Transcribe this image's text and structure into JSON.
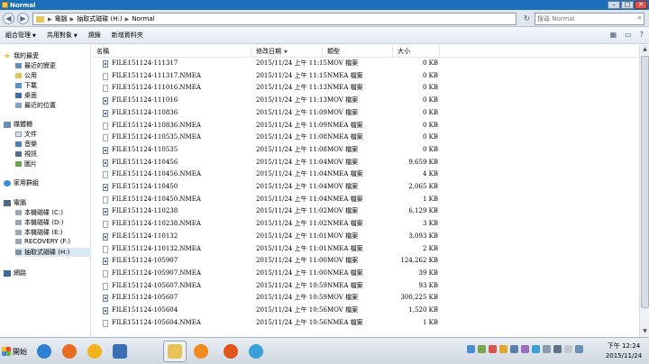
{
  "window": {
    "title": "Normal",
    "controls": {
      "minimize": "–",
      "maximize": "□",
      "close": "✕"
    }
  },
  "address": {
    "crumbs": [
      "電腦",
      "抽取式磁碟 (H:)",
      "Normal"
    ],
    "search_placeholder": "搜尋 Normal"
  },
  "toolbar": {
    "organize": "組合管理",
    "share": "共用對象",
    "burn": "燒錄",
    "new_folder": "新增資料夾"
  },
  "nav": {
    "favorites": {
      "label": "我的最愛",
      "items": [
        "最近的變更",
        "公用",
        "下載",
        "桌面",
        "最近的位置"
      ]
    },
    "libraries": {
      "label": "媒體櫃",
      "items": [
        "文件",
        "音樂",
        "視訊",
        "圖片"
      ]
    },
    "homegroup": "家用群組",
    "computer": {
      "label": "電腦",
      "items": [
        "本機磁碟 (C:)",
        "本機磁碟 (D:)",
        "本機磁碟 (E:)",
        "RECOVERY (F:)",
        "抽取式磁碟 (H:)"
      ]
    },
    "network": "網路"
  },
  "columns": {
    "name": "名稱",
    "date": "修改日期",
    "type": "類型",
    "size": "大小"
  },
  "files": [
    {
      "name": "FILE151124-111317",
      "date": "2015/11/24 上午 11:15",
      "type": "MOV 檔案",
      "size": "0 KB",
      "icon": "mov"
    },
    {
      "name": "FILE151124-111317.NMEA",
      "date": "2015/11/24 上午 11:15",
      "type": "NMEA 檔案",
      "size": "0 KB",
      "icon": "nmea"
    },
    {
      "name": "FILE151124-111016.NMEA",
      "date": "2015/11/24 上午 11:13",
      "type": "NMEA 檔案",
      "size": "0 KB",
      "icon": "nmea"
    },
    {
      "name": "FILE151124-111016",
      "date": "2015/11/24 上午 11:13",
      "type": "MOV 檔案",
      "size": "0 KB",
      "icon": "mov"
    },
    {
      "name": "FILE151124-110836",
      "date": "2015/11/24 上午 11:09",
      "type": "MOV 檔案",
      "size": "0 KB",
      "icon": "mov"
    },
    {
      "name": "FILE151124-110836.NMEA",
      "date": "2015/11/24 上午 11:09",
      "type": "NMEA 檔案",
      "size": "0 KB",
      "icon": "nmea"
    },
    {
      "name": "FILE151124-110535.NMEA",
      "date": "2015/11/24 上午 11:08",
      "type": "NMEA 檔案",
      "size": "0 KB",
      "icon": "nmea"
    },
    {
      "name": "FILE151124-110535",
      "date": "2015/11/24 上午 11:08",
      "type": "MOV 檔案",
      "size": "0 KB",
      "icon": "mov"
    },
    {
      "name": "FILE151124-110456",
      "date": "2015/11/24 上午 11:04",
      "type": "MOV 檔案",
      "size": "9,659 KB",
      "icon": "mov"
    },
    {
      "name": "FILE151124-110456.NMEA",
      "date": "2015/11/24 上午 11:04",
      "type": "NMEA 檔案",
      "size": "4 KB",
      "icon": "nmea"
    },
    {
      "name": "FILE151124-110450",
      "date": "2015/11/24 上午 11:04",
      "type": "MOV 檔案",
      "size": "2,065 KB",
      "icon": "mov"
    },
    {
      "name": "FILE151124-110450.NMEA",
      "date": "2015/11/24 上午 11:04",
      "type": "NMEA 檔案",
      "size": "1 KB",
      "icon": "nmea"
    },
    {
      "name": "FILE151124-110238",
      "date": "2015/11/24 上午 11:02",
      "type": "MOV 檔案",
      "size": "6,129 KB",
      "icon": "mov"
    },
    {
      "name": "FILE151124-110238.NMEA",
      "date": "2015/11/24 上午 11:02",
      "type": "NMEA 檔案",
      "size": "3 KB",
      "icon": "nmea"
    },
    {
      "name": "FILE151124-110132",
      "date": "2015/11/24 上午 11:01",
      "type": "MOV 檔案",
      "size": "3,093 KB",
      "icon": "mov"
    },
    {
      "name": "FILE151124-110132.NMEA",
      "date": "2015/11/24 上午 11:01",
      "type": "NMEA 檔案",
      "size": "2 KB",
      "icon": "nmea"
    },
    {
      "name": "FILE151124-105907",
      "date": "2015/11/24 上午 11:00",
      "type": "MOV 檔案",
      "size": "124,262 KB",
      "icon": "mov"
    },
    {
      "name": "FILE151124-105907.NMEA",
      "date": "2015/11/24 上午 11:00",
      "type": "NMEA 檔案",
      "size": "39 KB",
      "icon": "nmea"
    },
    {
      "name": "FILE151124-105607.NMEA",
      "date": "2015/11/24 上午 10:59",
      "type": "NMEA 檔案",
      "size": "93 KB",
      "icon": "nmea"
    },
    {
      "name": "FILE151124-105607",
      "date": "2015/11/24 上午 10:59",
      "type": "MOV 檔案",
      "size": "300,225 KB",
      "icon": "mov"
    },
    {
      "name": "FILE151124-105604",
      "date": "2015/11/24 上午 10:56",
      "type": "MOV 檔案",
      "size": "1,520 KB",
      "icon": "mov"
    },
    {
      "name": "FILE151124-105604.NMEA",
      "date": "2015/11/24 上午 10:56",
      "type": "NMEA 檔案",
      "size": "1 KB",
      "icon": "nmea"
    }
  ],
  "taskbar": {
    "start_label": "開始",
    "apps": [
      {
        "name": "ie-icon",
        "color": "#2f7fd3"
      },
      {
        "name": "firefox-icon",
        "color": "#e66a1f"
      },
      {
        "name": "pacman-icon",
        "color": "#f4b21b"
      },
      {
        "name": "media-player-icon",
        "color": "#3b6fb5"
      },
      {
        "name": "explorer-icon",
        "color": "#e8c35a"
      },
      {
        "name": "video-player-icon",
        "color": "#f08a1d"
      },
      {
        "name": "clock-app-icon",
        "color": "#e2561c"
      },
      {
        "name": "camera-app-icon",
        "color": "#3aa0d8"
      }
    ],
    "clock_time": "下午 12:24",
    "clock_date": "2015/11/24"
  }
}
